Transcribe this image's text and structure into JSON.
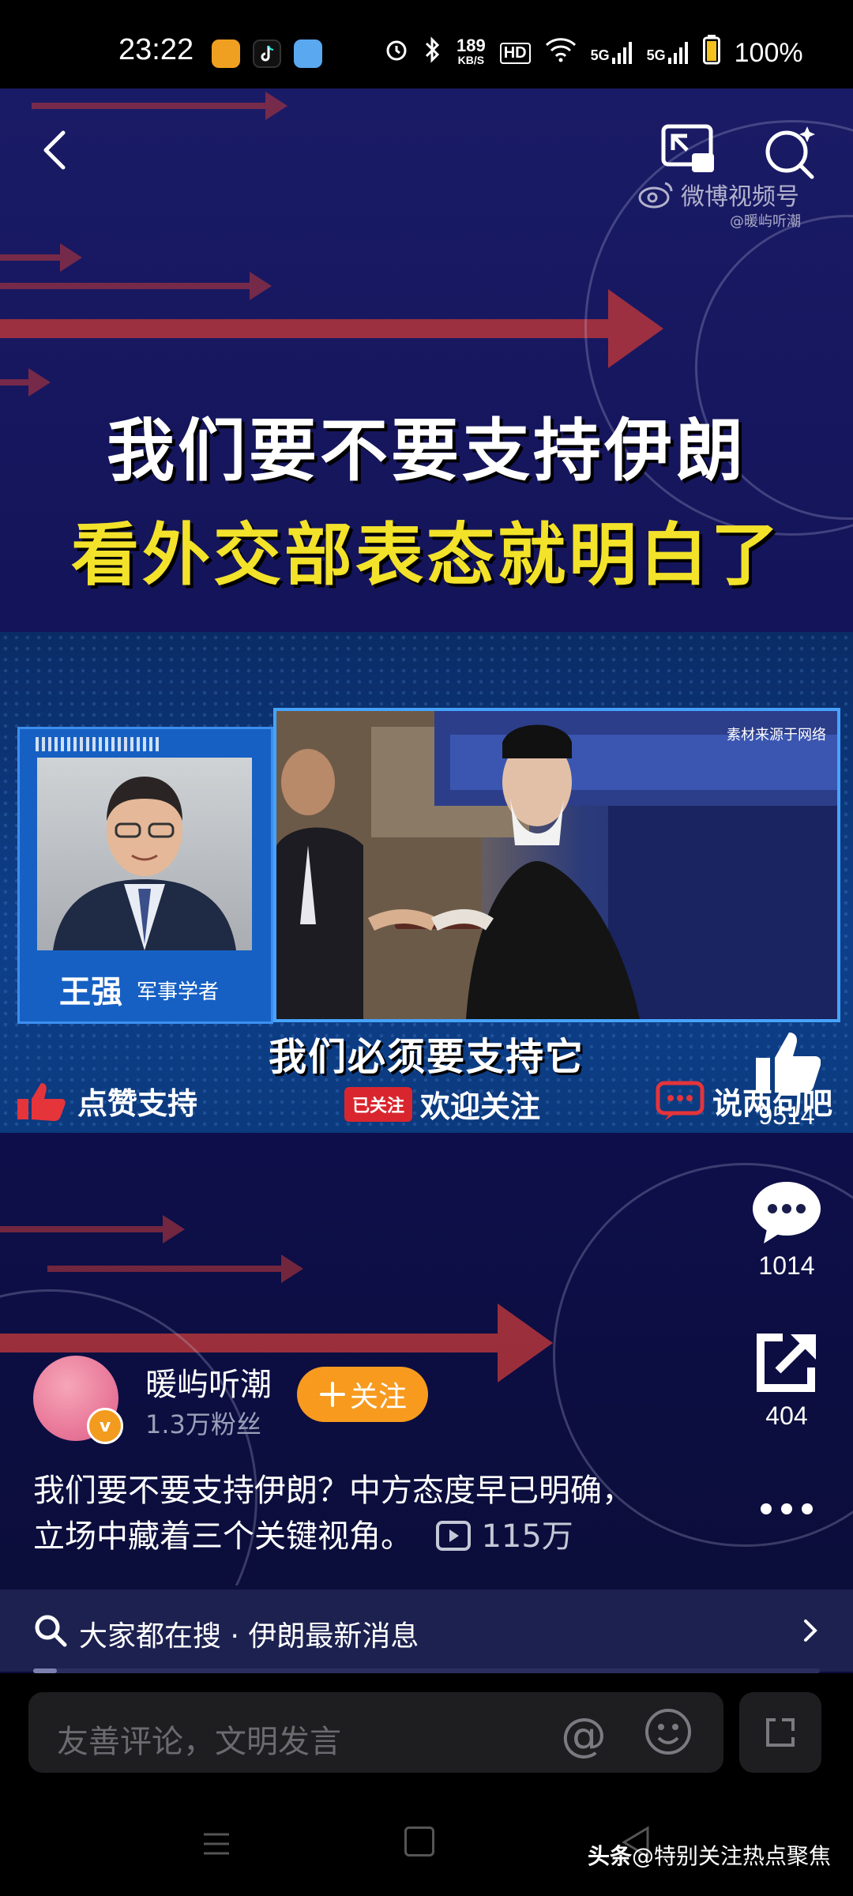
{
  "status_bar": {
    "time": "23:22",
    "net_speed_value": "189",
    "net_speed_unit": "KB/S",
    "hd_badge": "HD",
    "signal_1": "5G",
    "signal_2": "5G",
    "battery": "100%"
  },
  "video": {
    "watermark": "微博视频号",
    "watermark_handle": "@暖屿听潮",
    "headline_line1": "我们要不要支持伊朗",
    "headline_line2": "看外交部表态就明白了",
    "speaker_name": "王强",
    "speaker_title": "军事学者",
    "clip_source": "素材来源于网络",
    "subtitle": "我们必须要支持它",
    "strip_like": "点赞支持",
    "strip_followed_tag": "已关注",
    "strip_follow": "欢迎关注",
    "strip_comment": "说两句吧"
  },
  "actions": {
    "likes": "9514",
    "comments": "1014",
    "shares": "404"
  },
  "author": {
    "name": "暖屿听潮",
    "fans": "1.3万粉丝",
    "follow_label": "关注",
    "verified_mark": "v"
  },
  "description": {
    "line1": "我们要不要支持伊朗？中方态度早已明确，",
    "line2": "立场中藏着三个关键视角。",
    "plays": "115万"
  },
  "trending": {
    "text": "大家都在搜 · 伊朗最新消息",
    "progress": 0.03
  },
  "comment_bar": {
    "placeholder": "友善评论，文明发言"
  },
  "footer_credit": {
    "brand": "头条",
    "handle": "@特别关注热点聚焦"
  },
  "colors": {
    "accent_orange": "#f79a1e",
    "headline_yellow": "#f3e22a",
    "arrow_red": "#b5363a",
    "background": "#0b0d3a"
  }
}
